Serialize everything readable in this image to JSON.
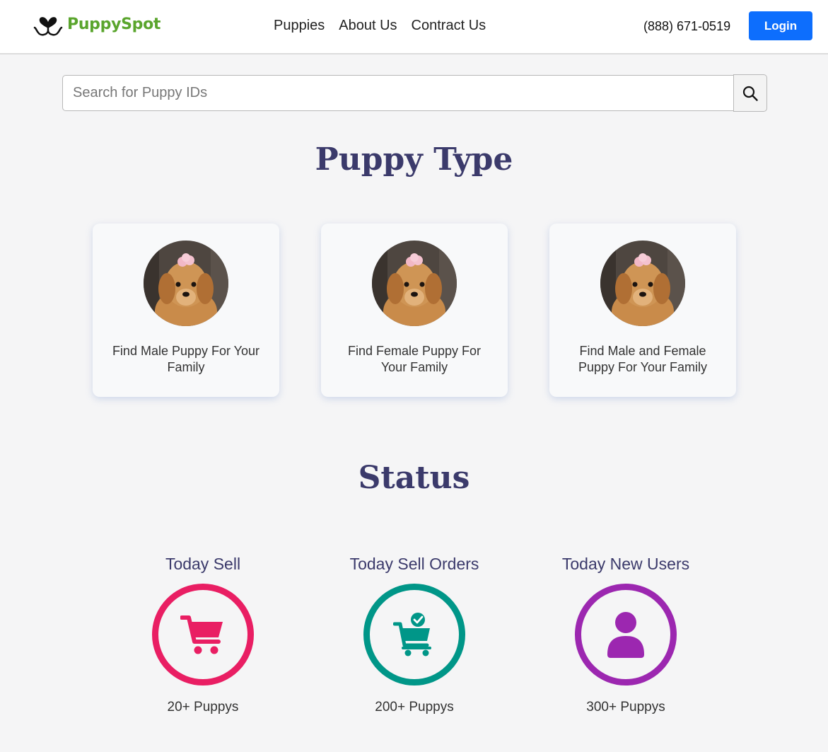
{
  "header": {
    "brand_name": "PuppySpot",
    "logo_icon": "dog-nose-logo-icon",
    "nav": [
      {
        "label": "Puppies"
      },
      {
        "label": "About Us"
      },
      {
        "label": "Contract Us"
      }
    ],
    "phone": "(888) 671-0519",
    "login_label": "Login",
    "accent_color": "#0d6efd",
    "brand_color": "#5aa52d"
  },
  "search": {
    "placeholder": "Search for Puppy IDs",
    "value": "",
    "button_icon": "search-icon"
  },
  "puppy_type": {
    "title": "Puppy Type",
    "cards": [
      {
        "label": "Find Male Puppy For Your Family",
        "image": "golden-retriever-puppy"
      },
      {
        "label": "Find Female Puppy For Your Family",
        "image": "golden-retriever-puppy"
      },
      {
        "label": "Find Male and Female Puppy For Your Family",
        "image": "golden-retriever-puppy"
      }
    ]
  },
  "status": {
    "title": "Status",
    "items": [
      {
        "title": "Today Sell",
        "count": "20+ Puppys",
        "icon": "cart-icon",
        "color": "#e91e63"
      },
      {
        "title": "Today Sell Orders",
        "count": "200+ Puppys",
        "icon": "cart-check-icon",
        "color": "#009688"
      },
      {
        "title": "Today New Users",
        "count": "300+ Puppys",
        "icon": "user-icon",
        "color": "#9c27b0"
      }
    ]
  }
}
